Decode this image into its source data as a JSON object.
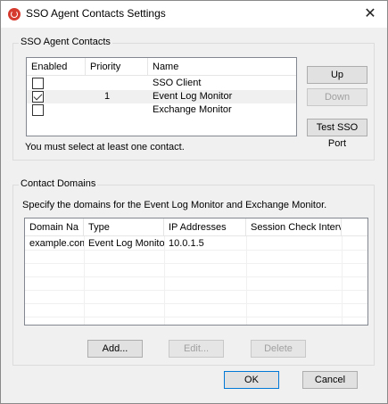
{
  "window": {
    "title": "SSO Agent Contacts Settings",
    "close_glyph": "✕"
  },
  "contacts_group": {
    "title": "SSO Agent Contacts",
    "columns": [
      "Enabled",
      "Priority",
      "Name"
    ],
    "rows": [
      {
        "enabled": false,
        "priority": "",
        "name": "SSO Client"
      },
      {
        "enabled": true,
        "priority": "1",
        "name": "Event Log Monitor"
      },
      {
        "enabled": false,
        "priority": "",
        "name": "Exchange Monitor"
      }
    ],
    "up_label": "Up",
    "down_label": "Down",
    "test_label": "Test SSO Port",
    "hint": "You must select at least one contact."
  },
  "domains_group": {
    "title": "Contact Domains",
    "description": "Specify the domains for the Event Log Monitor and Exchange Monitor.",
    "columns": [
      "Domain Na",
      "Type",
      "IP Addresses",
      "Session Check Interval"
    ],
    "rows": [
      {
        "domain": "example.com",
        "type": "Event Log Monitor",
        "ip": "10.0.1.5",
        "interval": ""
      }
    ],
    "add_label": "Add...",
    "edit_label": "Edit...",
    "delete_label": "Delete"
  },
  "footer": {
    "ok_label": "OK",
    "cancel_label": "Cancel"
  },
  "colors": {
    "selected_row": "#f0f0f0",
    "default_button_border": "#0078d7",
    "app_icon": "#d63b2f"
  }
}
